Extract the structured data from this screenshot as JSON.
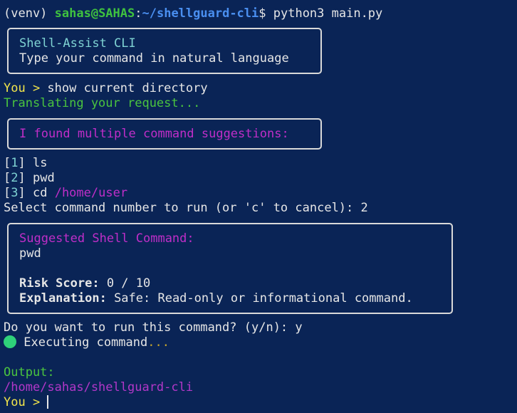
{
  "prompt": {
    "venv": "(venv) ",
    "user_host": "sahas@SAHAS",
    "colon": ":",
    "path": "~/shellguard-cli",
    "dollar": "$ ",
    "command": "python3 main.py"
  },
  "header_box": {
    "title": "Shell-Assist CLI",
    "subtitle": "Type your command in natural language"
  },
  "input1": {
    "label": "You > ",
    "text": "show current directory"
  },
  "translating": "Translating your request...",
  "suggestions_box": {
    "title": "I found multiple command suggestions:"
  },
  "options": [
    {
      "index": "1",
      "command": "ls",
      "arg": ""
    },
    {
      "index": "2",
      "command": "pwd",
      "arg": ""
    },
    {
      "index": "3",
      "command": "cd ",
      "arg": "/home/user"
    }
  ],
  "select_prompt": "Select command number to run (or 'c' to cancel): 2",
  "command_box": {
    "title": "Suggested Shell Command:",
    "command": "pwd",
    "risk_label": "Risk Score:",
    "risk_value": " 0 / 10",
    "explanation_label": "Explanation:",
    "explanation_value": " Safe: Read-only or informational command."
  },
  "confirm_prompt": "Do you want to run this command? (y/n): y",
  "executing": {
    "text": " Executing command",
    "dots": "..."
  },
  "output": {
    "label": "Output:",
    "value": "/home/sahas/shellguard-cli"
  },
  "input2": {
    "label": "You > "
  },
  "colors": {
    "background": "#0a2456",
    "prompt_user": "#3fc23f",
    "prompt_path": "#4a8ff0",
    "you_label": "#f2e54b",
    "cyan": "#7fd3d3",
    "magenta": "#c02ec8",
    "status_dot": "#2fd17a"
  }
}
